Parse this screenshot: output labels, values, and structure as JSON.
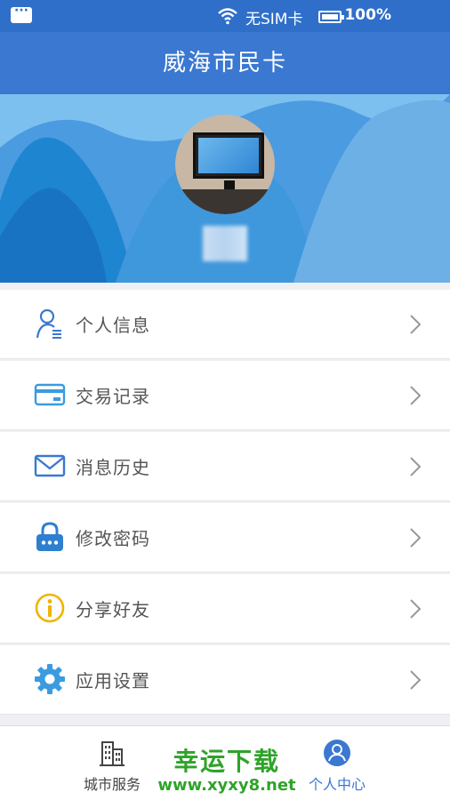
{
  "status_bar": {
    "sim_status": "无SIM卡",
    "battery": "100%"
  },
  "header": {
    "title": "威海市民卡"
  },
  "menu": {
    "items": [
      {
        "label": "个人信息",
        "icon": "user-info-icon"
      },
      {
        "label": "交易记录",
        "icon": "card-icon"
      },
      {
        "label": "消息历史",
        "icon": "envelope-icon"
      },
      {
        "label": "修改密码",
        "icon": "lock-icon"
      },
      {
        "label": "分享好友",
        "icon": "info-icon"
      },
      {
        "label": "应用设置",
        "icon": "gear-icon"
      }
    ]
  },
  "tab_bar": {
    "tabs": [
      {
        "label": "城市服务",
        "icon": "buildings-icon"
      },
      {
        "label": "个人中心",
        "icon": "person-icon"
      }
    ],
    "watermark_line1": "幸运下载",
    "watermark_line2": "www.xyxy8.net"
  },
  "colors": {
    "accent": "#3a78d2",
    "status_bar": "#2f6fc9",
    "watermark": "#2fa329"
  }
}
